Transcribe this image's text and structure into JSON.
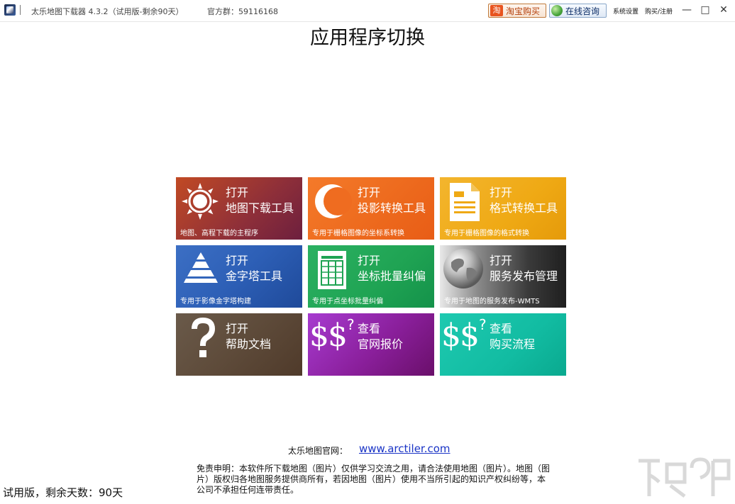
{
  "titlebar": {
    "app_title": "太乐地图下载器 4.3.2（试用版-剩余90天）",
    "group_label": "官方群：59116168",
    "taobao_badge": "淘",
    "taobao_label": "淘宝购买",
    "consult_label": "在线咨询",
    "settings_label": "系统设置",
    "register_label": "购买/注册",
    "minimize_glyph": "—",
    "maximize_glyph": "□",
    "close_glyph": "✕"
  },
  "page": {
    "title": "应用程序切换"
  },
  "tiles": [
    {
      "action": "打开",
      "name": "地图下载工具",
      "desc": "地图、高程下载的主程序",
      "icon": "sun-icon",
      "color": "#a93a33"
    },
    {
      "action": "打开",
      "name": "投影转换工具",
      "desc": "专用于栅格图像的坐标系转换",
      "icon": "crescent-icon",
      "color": "#ef6c20"
    },
    {
      "action": "打开",
      "name": "格式转换工具",
      "desc": "专用于栅格图像的格式转换",
      "icon": "document-icon",
      "color": "#efa914"
    },
    {
      "action": "打开",
      "name": "金字塔工具",
      "desc": "专用于影像金字塔构建",
      "icon": "pyramid-icon",
      "color": "#2d5fb6"
    },
    {
      "action": "打开",
      "name": "坐标批量纠偏",
      "desc": "专用于点坐标批量纠偏",
      "icon": "ledger-icon",
      "color": "#1fa353"
    },
    {
      "action": "打开",
      "name": "服务发布管理",
      "desc": "专用于地图的服务发布-WMTS",
      "icon": "globe-icon",
      "color": "#3a3a3a"
    },
    {
      "action": "打开",
      "name": "帮助文档",
      "desc": "",
      "icon": "question-icon",
      "color": "#5e4b3a"
    },
    {
      "action": "查看",
      "name": "官网报价",
      "desc": "",
      "icon": "dollar-icon",
      "color": "#8a1f9b"
    },
    {
      "action": "查看",
      "name": "购买流程",
      "desc": "",
      "icon": "dollar-icon",
      "color": "#12bca2"
    }
  ],
  "footer": {
    "website_label": "太乐地图官网：",
    "website_url": "www.arctiler.com",
    "disclaimer": "免责申明：本软件所下载地图（图片）仅供学习交流之用，请合法使用地图（图片）。地图（图片）版权归各地图服务提供商所有，若因地图（图片）使用不当所引起的知识产权纠纷等，本公司不承担任何连带责任。",
    "trial_status": "试用版，剩余天数：90天"
  }
}
